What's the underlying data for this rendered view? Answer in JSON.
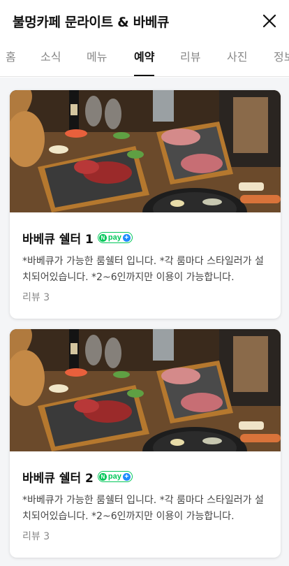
{
  "header": {
    "title": "불멍카페 문라이트 & 바베큐",
    "close_icon": "close-icon"
  },
  "tabs": [
    {
      "label": "홈",
      "active": false
    },
    {
      "label": "소식",
      "active": false
    },
    {
      "label": "메뉴",
      "active": false
    },
    {
      "label": "예약",
      "active": true
    },
    {
      "label": "리뷰",
      "active": false
    },
    {
      "label": "사진",
      "active": false
    },
    {
      "label": "정보",
      "active": false
    }
  ],
  "colors": {
    "npay_green": "#03c75a",
    "npay_plus_blue": "#1e8cff",
    "active_tab": "#111111",
    "inactive_tab": "#888888"
  },
  "items": [
    {
      "title": "바베큐 쉘터 1",
      "badge": {
        "n": "N",
        "text": "pay",
        "plus": "+"
      },
      "description": "*바베큐가 가능한 룸쉘터 입니다. *각 룸마다 스타일러가 설치되어있습니다. *2~6인까지만 이용이 가능합니다.",
      "review": "리뷰 3"
    },
    {
      "title": "바베큐 쉘터 2",
      "badge": {
        "n": "N",
        "text": "pay",
        "plus": "+"
      },
      "description": "*바베큐가 가능한 룸쉘터 입니다. *각 룸마다 스타일러가 설치되어있습니다. *2~6인까지만 이용이 가능합니다.",
      "review": "리뷰 3"
    }
  ]
}
